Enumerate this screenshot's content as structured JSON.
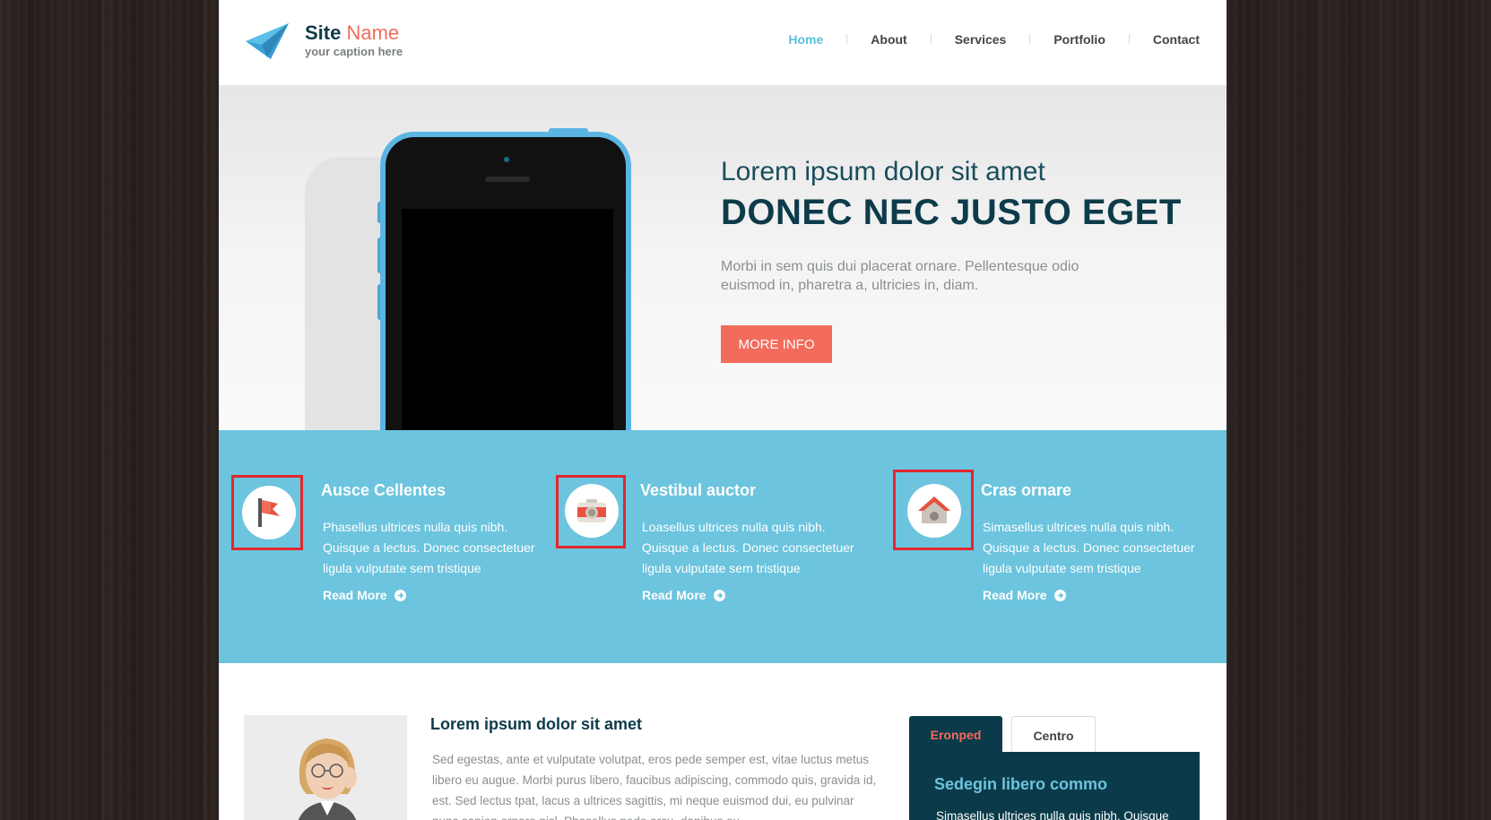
{
  "header": {
    "site_name_bold": "Site",
    "site_name_light": "Name",
    "caption": "your caption here",
    "nav": [
      {
        "label": "Home",
        "active": true
      },
      {
        "label": "About",
        "active": false
      },
      {
        "label": "Services",
        "active": false
      },
      {
        "label": "Portfolio",
        "active": false
      },
      {
        "label": "Contact",
        "active": false
      }
    ]
  },
  "hero": {
    "subtitle": "Lorem ipsum dolor sit amet",
    "title": "DONEC NEC JUSTO EGET",
    "text": "Morbi in sem quis dui placerat ornare. Pellentesque odio euismod in, pharetra a, ultricies in, diam.",
    "button_label": "MORE INFO"
  },
  "features": [
    {
      "icon": "flag-icon",
      "title": "Ausce Cellentes",
      "text": "Phasellus ultrices nulla quis nibh. Quisque a lectus. Donec consectetuer ligula vulputate sem tristique",
      "link": "Read More"
    },
    {
      "icon": "camera-icon",
      "title": "Vestibul auctor",
      "text": "Loasellus ultrices nulla quis nibh. Quisque a lectus. Donec consectetuer ligula vulputate sem tristique",
      "link": "Read More"
    },
    {
      "icon": "home-icon",
      "title": "Cras ornare",
      "text": "Simasellus ultrices nulla quis nibh. Quisque a lectus. Donec consectetuer ligula vulputate sem tristique",
      "link": "Read More"
    }
  ],
  "content": {
    "title": "Lorem ipsum dolor sit amet",
    "text": "Sed egestas, ante et vulputate volutpat, eros pede semper est, vitae luctus metus libero eu augue. Morbi purus libero, faucibus adipiscing, commodo quis, gravida id, est. Sed lectus tpat, lacus a ultrices sagittis, mi neque euismod dui, eu pulvinar nunc sapien ornare nisl. Phasellus pede arcu, dapibus eu"
  },
  "tabs": {
    "items": [
      "Eronped",
      "Centro"
    ],
    "panel_title": "Sedegin libero commo",
    "panel_text": "Simasellus ultrices nulla quis nibh. Quisque"
  },
  "colors": {
    "accent_coral": "#f26b5b",
    "accent_blue": "#6cc4de",
    "dark_teal": "#0b3b4a",
    "highlight_box": "#e3262c"
  }
}
